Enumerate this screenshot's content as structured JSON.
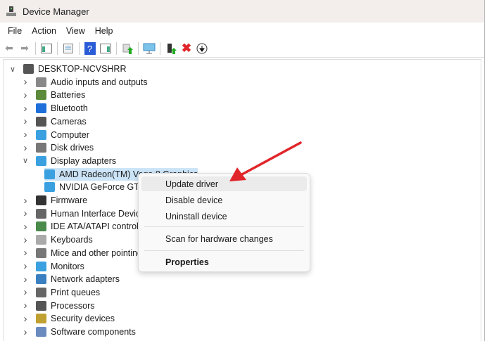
{
  "window": {
    "title": "Device Manager"
  },
  "menu": [
    "File",
    "Action",
    "View",
    "Help"
  ],
  "toolbar": [
    "back-icon",
    "forward-icon",
    "show-hide-console-tree-icon",
    "properties-icon",
    "help-icon",
    "action-pane-icon",
    "update-driver-icon",
    "scan-hardware-icon",
    "enable-device-icon",
    "uninstall-icon",
    "download-icon"
  ],
  "tree": {
    "root": "DESKTOP-NCVSHRR",
    "items": [
      {
        "label": "Audio inputs and outputs",
        "color": "#888888"
      },
      {
        "label": "Batteries",
        "color": "#5a8a3a"
      },
      {
        "label": "Bluetooth",
        "color": "#1e6fd9"
      },
      {
        "label": "Cameras",
        "color": "#555555"
      },
      {
        "label": "Computer",
        "color": "#3aa0e0"
      },
      {
        "label": "Disk drives",
        "color": "#777777"
      },
      {
        "label": "Display adapters",
        "color": "#3aa0e0",
        "expanded": true,
        "children": [
          "AMD Radeon(TM) Vega 8 Graphics",
          "NVIDIA GeForce GTX"
        ]
      },
      {
        "label": "Firmware",
        "color": "#333333"
      },
      {
        "label": "Human Interface Devices",
        "color": "#666666"
      },
      {
        "label": "IDE ATA/ATAPI controllers",
        "color": "#4a8a4a"
      },
      {
        "label": "Keyboards",
        "color": "#aaaaaa"
      },
      {
        "label": "Mice and other pointing devices",
        "color": "#777777"
      },
      {
        "label": "Monitors",
        "color": "#3aa0e0"
      },
      {
        "label": "Network adapters",
        "color": "#3a80c0"
      },
      {
        "label": "Print queues",
        "color": "#666666"
      },
      {
        "label": "Processors",
        "color": "#555555"
      },
      {
        "label": "Security devices",
        "color": "#c0a030"
      },
      {
        "label": "Software components",
        "color": "#6a8ac0"
      }
    ]
  },
  "context_menu": {
    "update": "Update driver",
    "disable": "Disable device",
    "uninstall": "Uninstall device",
    "scan": "Scan for hardware changes",
    "properties": "Properties"
  },
  "accent": "#e0262b"
}
